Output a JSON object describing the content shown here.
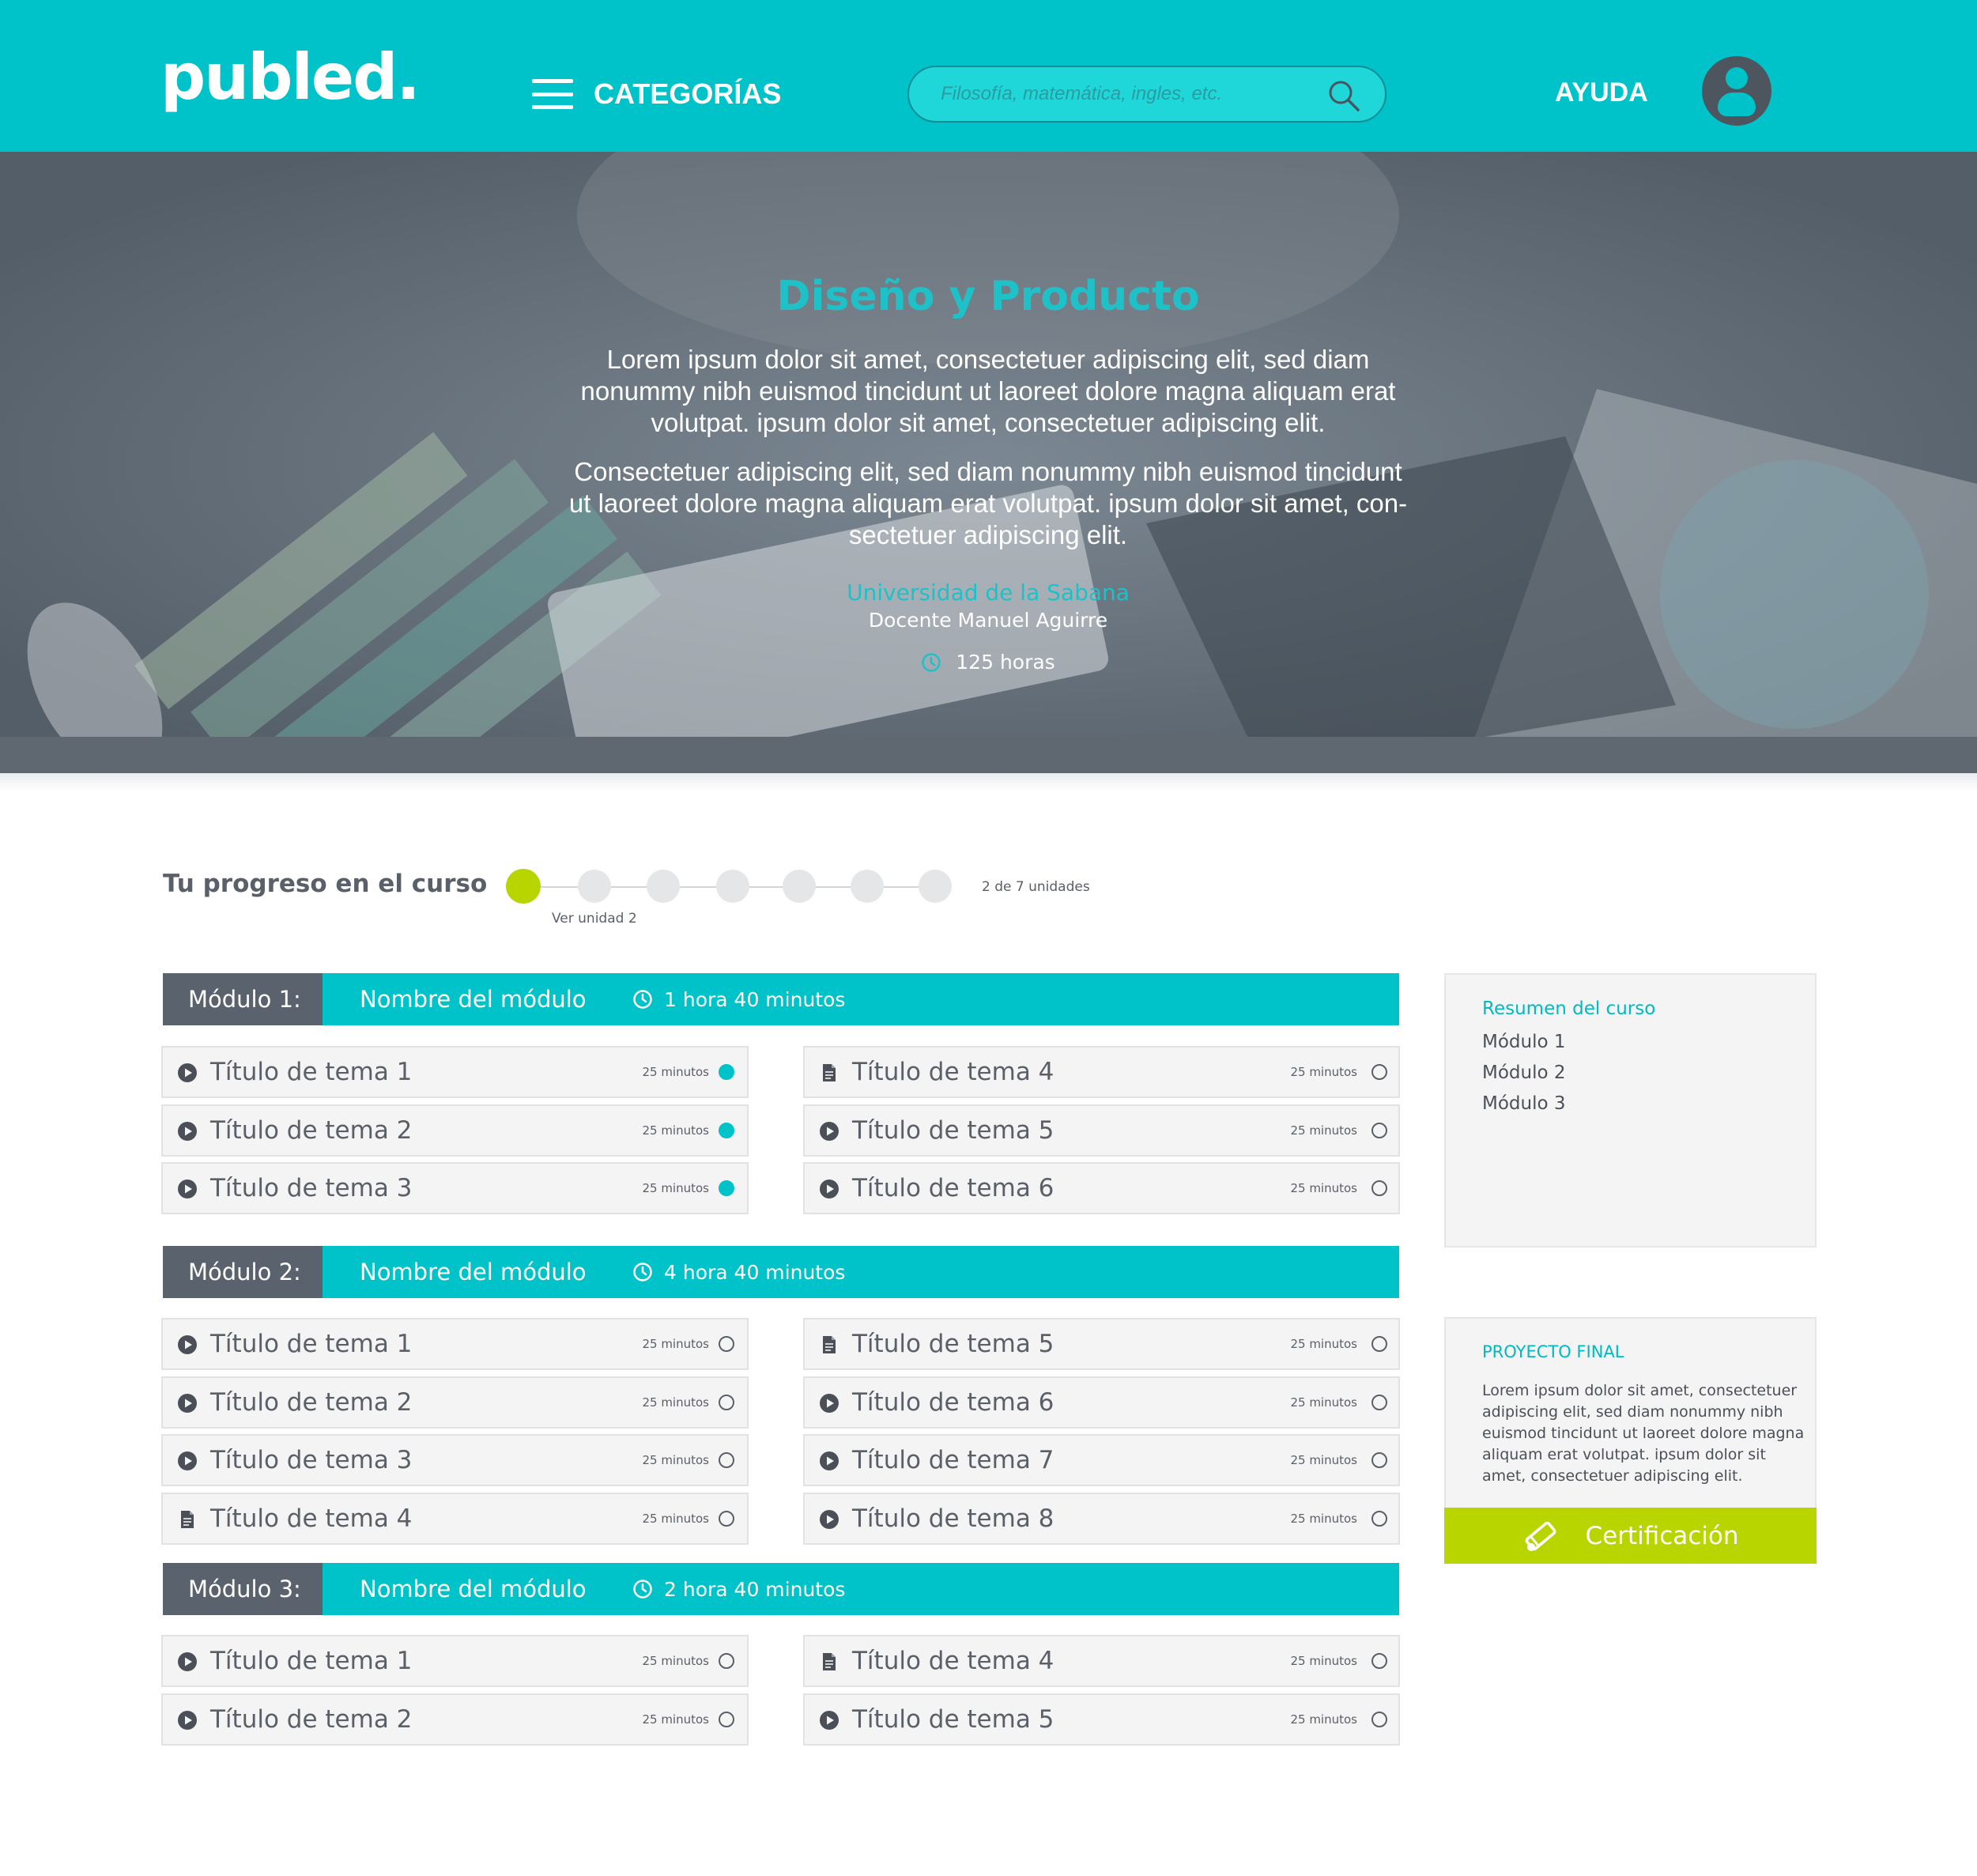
{
  "header": {
    "logo": "publed.",
    "categories_label": "CATEGORÍAS",
    "search_placeholder": "Filosofía, matemática, ingles, etc.",
    "help_label": "AYUDA"
  },
  "hero": {
    "title": "Diseño y Producto",
    "paragraph_1": "Lorem ipsum dolor sit amet, consectetuer adipiscing elit, sed diam nonummy nibh euismod tincidunt ut laoreet dolore magna aliquam erat volutpat. ipsum dolor sit amet, consectetuer adipiscing elit.",
    "paragraph_2": "Consectetuer adipiscing elit, sed diam nonummy nibh euismod tincidunt ut laoreet dolore magna aliquam erat volutpat. ipsum dolor sit amet, con-sectetuer adipiscing elit.",
    "university": "Universidad de la Sabana",
    "teacher": "Docente Manuel Aguirre",
    "hours": "125 horas"
  },
  "progress": {
    "label": "Tu progreso en el curso",
    "count": "2 de 7 unidades",
    "link": "Ver unidad 2",
    "total_units": 7,
    "active_unit": 1
  },
  "modules": [
    {
      "number": "Módulo 1:",
      "name": "Nombre del módulo",
      "duration": "1 hora 40 minutos",
      "left": [
        {
          "icon": "play-icon",
          "title": "Título de tema 1",
          "duration": "25 minutos",
          "done": true
        },
        {
          "icon": "play-icon",
          "title": "Título de tema 2",
          "duration": "25 minutos",
          "done": true
        },
        {
          "icon": "play-icon",
          "title": "Título de tema 3",
          "duration": "25 minutos",
          "done": true
        }
      ],
      "right": [
        {
          "icon": "document-icon",
          "title": "Título de tema 4",
          "duration": "25 minutos",
          "done": false
        },
        {
          "icon": "play-icon",
          "title": "Título de tema 5",
          "duration": "25 minutos",
          "done": false
        },
        {
          "icon": "play-icon",
          "title": "Título de tema 6",
          "duration": "25 minutos",
          "done": false
        }
      ]
    },
    {
      "number": "Módulo 2:",
      "name": "Nombre del módulo",
      "duration": "4 hora 40 minutos",
      "left": [
        {
          "icon": "play-icon",
          "title": "Título de tema 1",
          "duration": "25 minutos",
          "done": false
        },
        {
          "icon": "play-icon",
          "title": "Título de tema 2",
          "duration": "25 minutos",
          "done": false
        },
        {
          "icon": "play-icon",
          "title": "Título de tema 3",
          "duration": "25 minutos",
          "done": false
        },
        {
          "icon": "document-icon",
          "title": "Título de tema 4",
          "duration": "25 minutos",
          "done": false
        }
      ],
      "right": [
        {
          "icon": "document-icon",
          "title": "Título de tema 5",
          "duration": "25 minutos",
          "done": false
        },
        {
          "icon": "play-icon",
          "title": "Título de tema 6",
          "duration": "25 minutos",
          "done": false
        },
        {
          "icon": "play-icon",
          "title": "Título de tema 7",
          "duration": "25 minutos",
          "done": false
        },
        {
          "icon": "play-icon",
          "title": "Título de tema 8",
          "duration": "25 minutos",
          "done": false
        }
      ]
    },
    {
      "number": "Módulo 3:",
      "name": "Nombre del módulo",
      "duration": "2 hora 40 minutos",
      "left": [
        {
          "icon": "play-icon",
          "title": "Título de tema 1",
          "duration": "25 minutos",
          "done": false
        },
        {
          "icon": "play-icon",
          "title": "Título de tema 2",
          "duration": "25 minutos",
          "done": false
        }
      ],
      "right": [
        {
          "icon": "document-icon",
          "title": "Título de tema 4",
          "duration": "25 minutos",
          "done": false
        },
        {
          "icon": "play-icon",
          "title": "Título de tema 5",
          "duration": "25 minutos",
          "done": false
        }
      ]
    }
  ],
  "summary": {
    "title": "Resumen del curso",
    "items": [
      "Módulo 1",
      "Módulo 2",
      "Módulo 3"
    ]
  },
  "final_project": {
    "title": "PROYECTO FINAL",
    "text": "Lorem ipsum dolor sit amet, consectetuer adipiscing elit, sed diam nonummy nibh euismod tincidunt ut laoreet dolore magna aliquam erat volutpat. ipsum dolor sit amet, consectetuer adipiscing elit.",
    "cert_label": "Certificación"
  },
  "colors": {
    "brand": "#00c2c9",
    "dark": "#5a626d",
    "accent": "#b8d500"
  }
}
